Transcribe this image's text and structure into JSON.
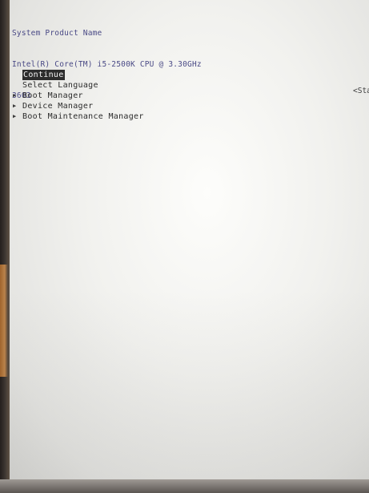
{
  "system_info": {
    "line1": "System Product Name",
    "line2": "Intel(R) Core(TM) i5-2500K CPU @ 3.30GHz",
    "line3": "3603"
  },
  "menu": {
    "items": [
      {
        "label": "Continue",
        "submenu": false,
        "selected": true
      },
      {
        "label": "Select Language",
        "submenu": false,
        "selected": false
      },
      {
        "label": "Boot Manager",
        "submenu": true,
        "selected": false
      },
      {
        "label": "Device Manager",
        "submenu": true,
        "selected": false
      },
      {
        "label": "Boot Maintenance Manager",
        "submenu": true,
        "selected": false
      }
    ]
  },
  "right_hint": "<Sta",
  "icons": {
    "submenu_marker": "triangle-right-icon"
  },
  "colors": {
    "info_text": "#4a4a86",
    "menu_text": "#2b2b2b",
    "highlight_bg": "#2c2c2c",
    "highlight_text": "#f4f4f4",
    "screen_bg": "#f1f1ee"
  }
}
